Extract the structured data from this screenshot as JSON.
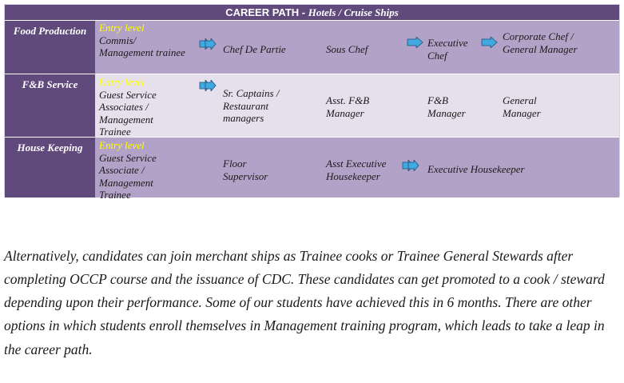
{
  "table": {
    "title": "CAREER PATH -",
    "title_sub": "Hotels / Cruise Ships",
    "rows": [
      {
        "dept": "Food Production",
        "entry": "Entry level",
        "role1": "Commis/ Management trainee",
        "role2": "Chef De Partie",
        "role3": "Sous Chef",
        "role4": "Executive Chef",
        "role5": "Corporate Chef / General Manager"
      },
      {
        "dept": "F&B Service",
        "entry": "Entry level",
        "role1": "Guest Service Associates / Management Trainee",
        "role2": "Sr. Captains / Restaurant managers",
        "role3": "Asst. F&B Manager",
        "role4": "F&B Manager",
        "role5": "General Manager"
      },
      {
        "dept": "House Keeping",
        "entry": "Entry level",
        "role1": "Guest Service Associate / Management Trainee",
        "role2": "Floor Supervisor",
        "role3": "Asst Executive Housekeeper",
        "role4": "Executive Housekeeper"
      }
    ]
  },
  "paragraph": "Alternatively, candidates can join merchant ships as Trainee cooks or Trainee General Stewards after completing OCCP course and the issuance of CDC.  These candidates can get promoted to a cook / steward depending upon their performance. Some of our students have achieved this in 6 months. There are other options in which students enroll themselves in Management training program, which leads to take a leap in the career path.",
  "colors": {
    "header_purple": "#604a7b",
    "row_dark": "#b3a2c7",
    "row_light": "#e5e0ec",
    "entry_yellow": "#ffff00",
    "arrow_blue": "#3fa9e0"
  },
  "icons": [
    "double-arrow-icon",
    "arrow-right-icon"
  ]
}
